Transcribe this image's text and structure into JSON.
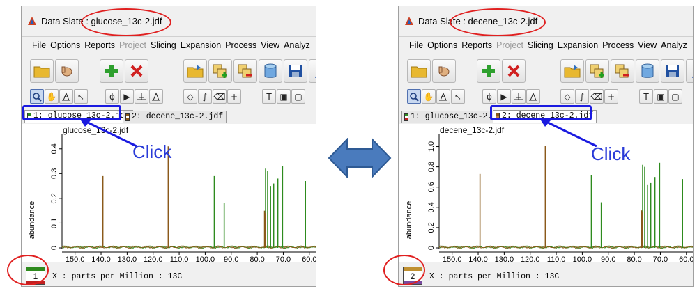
{
  "colors": {
    "annotation_red": "#e02020",
    "annotation_blue": "#1a1ae0",
    "click_text": "#2a3bd8",
    "arrow_fill": "#4a7bbd",
    "spectrum_green": "#2e8b1e",
    "spectrum_brown": "#8b5a1a"
  },
  "left_window": {
    "title": "Data Slate : glucose_13c-2.jdf",
    "menu": [
      "File",
      "Options",
      "Reports",
      "Project",
      "Slicing",
      "Expansion",
      "Process",
      "View",
      "Analyz"
    ],
    "menu_disabled": [
      "Project"
    ],
    "tabs": [
      {
        "label": "1: glucose_13c-2.jdf",
        "active": true
      },
      {
        "label": "2: decene_13c-2.jdf",
        "active": false
      }
    ],
    "plot_title": "glucose_13c-2.jdf",
    "y_axis_label": "abundance",
    "y_ticks": [
      "0.4",
      "0.3",
      "0.2",
      "0.1",
      "0"
    ],
    "x_ticks": [
      "150.0",
      "140.0",
      "130.0",
      "120.0",
      "110.0",
      "100.0",
      "90.0",
      "80.0",
      "70.0",
      "60.0"
    ],
    "x_axis_label": "X : parts per Million : 13C",
    "slot_number": "1",
    "click_label": "Click"
  },
  "right_window": {
    "title": "Data Slate : decene_13c-2.jdf",
    "menu": [
      "File",
      "Options",
      "Reports",
      "Project",
      "Slicing",
      "Expansion",
      "Process",
      "View",
      "Analyz"
    ],
    "menu_disabled": [
      "Project"
    ],
    "tabs": [
      {
        "label": "1: glucose_13c-2.jdf",
        "active": false
      },
      {
        "label": "2: decene_13c-2.jdf",
        "active": true
      }
    ],
    "plot_title": "decene_13c-2.jdf",
    "y_axis_label": "abundance",
    "y_ticks": [
      "1.0",
      "0.8",
      "0.6",
      "0.4",
      "0.2",
      "0"
    ],
    "x_ticks": [
      "150.0",
      "140.0",
      "130.0",
      "120.0",
      "110.0",
      "100.0",
      "90.0",
      "80.0",
      "70.0",
      "60.0"
    ],
    "x_axis_label": "X : parts per Million : 13C",
    "slot_number": "2",
    "click_label": "Click"
  },
  "toolbar_icons": [
    "open-folder-icon",
    "hand-icon",
    "add-icon",
    "delete-icon",
    "open-file-icon",
    "overlay-add-icon",
    "overlay-remove-icon",
    "cylinder-icon",
    "save-icon",
    "person-icon"
  ],
  "tool_icons": [
    "zoom-icon",
    "pan-icon",
    "peak-pick-icon",
    "pointer-icon",
    "phase-icon",
    "cursor-icon",
    "baseline-icon",
    "integral-peak-icon",
    "diamond-icon",
    "integral-icon",
    "eraser-icon",
    "crosshair-icon",
    "text-icon",
    "frame-icon",
    "layout-icon"
  ],
  "chart_data": [
    {
      "type": "line",
      "title": "glucose_13c-2.jdf",
      "xlabel": "X : parts per Million : 13C",
      "ylabel": "abundance",
      "xlim": [
        155,
        57
      ],
      "ylim": [
        0,
        0.45
      ],
      "series": [
        {
          "name": "1: glucose_13c-2.jdf",
          "color": "#2e8b1e",
          "peaks": [
            [
              96.5,
              0.29
            ],
            [
              92.7,
              0.18
            ],
            [
              76.8,
              0.32
            ],
            [
              76.0,
              0.31
            ],
            [
              74.9,
              0.25
            ],
            [
              73.7,
              0.26
            ],
            [
              72.1,
              0.28
            ],
            [
              70.3,
              0.33
            ],
            [
              61.5,
              0.27
            ]
          ]
        },
        {
          "name": "2: decene_13c-2.jdf",
          "color": "#8b5a1a",
          "peaks": [
            [
              139.3,
              0.29
            ],
            [
              114.2,
              0.41
            ],
            [
              77.2,
              0.15
            ],
            [
              76.9,
              0.14
            ]
          ]
        }
      ]
    },
    {
      "type": "line",
      "title": "decene_13c-2.jdf",
      "xlabel": "X : parts per Million : 13C",
      "ylabel": "abundance",
      "xlim": [
        155,
        57
      ],
      "ylim": [
        0,
        1.1
      ],
      "series": [
        {
          "name": "1: glucose_13c-2.jdf",
          "color": "#2e8b1e",
          "peaks": [
            [
              96.5,
              0.72
            ],
            [
              92.7,
              0.45
            ],
            [
              76.8,
              0.82
            ],
            [
              76.0,
              0.8
            ],
            [
              74.9,
              0.62
            ],
            [
              73.7,
              0.64
            ],
            [
              72.1,
              0.7
            ],
            [
              70.3,
              0.84
            ],
            [
              61.5,
              0.68
            ]
          ]
        },
        {
          "name": "2: decene_13c-2.jdf",
          "color": "#8b5a1a",
          "peaks": [
            [
              139.3,
              0.73
            ],
            [
              114.2,
              1.01
            ],
            [
              77.2,
              0.37
            ],
            [
              76.9,
              0.35
            ]
          ]
        }
      ]
    }
  ]
}
